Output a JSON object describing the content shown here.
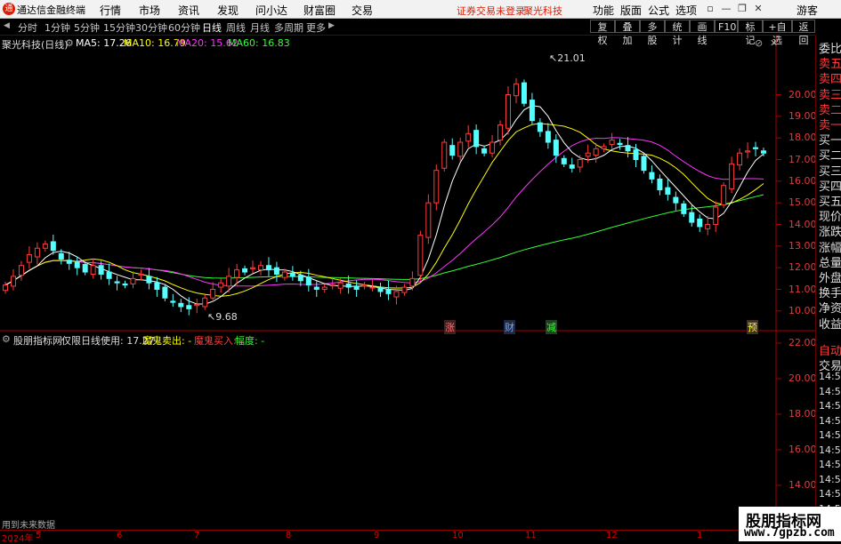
{
  "topbar": {
    "logo": "通",
    "app_title": "通达信金融终端",
    "menu": [
      "行情",
      "市场",
      "资讯",
      "发现",
      "问小达",
      "财富圈",
      "交易"
    ],
    "notice": "证券交易未登录",
    "stock_name": "聚光科技",
    "right_menu": [
      "功能",
      "版面",
      "公式",
      "选项"
    ],
    "guest": "游客"
  },
  "periodbar": {
    "periods": [
      "分时",
      "1分钟",
      "5分钟",
      "15分钟",
      "30分钟",
      "60分钟",
      "日线",
      "周线",
      "月线",
      "多周期",
      "更多"
    ],
    "active": "日线",
    "tools": [
      "复权",
      "叠加",
      "多股",
      "统计",
      "画线",
      "F10",
      "标记",
      "+自选",
      "返回"
    ]
  },
  "main_chart": {
    "title": "聚光科技(日线)",
    "ma": [
      {
        "label": "MA5: 17.26",
        "color": "#ffffff"
      },
      {
        "label": "MA10: 16.79",
        "color": "#ffff00"
      },
      {
        "label": "MA20: 15.62",
        "color": "#ff33ff"
      },
      {
        "label": "MA60: 16.83",
        "color": "#33ff33"
      }
    ],
    "y_ticks": [
      "20.00",
      "19.00",
      "18.00",
      "17.00",
      "16.00",
      "15.00",
      "14.00",
      "13.00",
      "12.00",
      "11.00",
      "10.00"
    ],
    "high_label": "21.01",
    "low_label": "9.68",
    "markers": [
      "涨",
      "财",
      "减",
      "预"
    ]
  },
  "indicator": {
    "name": "股朋指标网",
    "formula": "仅限日线使用: 17.27",
    "sell_label": "魔鬼卖出: -",
    "buy_label": "魔鬼买入: -",
    "range_label": "幅度: -",
    "y_ticks": [
      "22.00",
      "20.00",
      "18.00",
      "16.00",
      "14.00",
      "12.00"
    ],
    "footer": "用到未来数据"
  },
  "sidebar": {
    "quote_items": [
      "委比",
      "卖五",
      "卖四",
      "卖三",
      "卖二",
      "卖一",
      "买一",
      "买二",
      "买三",
      "买四",
      "买五",
      "现价",
      "涨跌",
      "涨幅",
      "总量",
      "外盘",
      "换手",
      "净资",
      "收益"
    ],
    "lower_items": [
      "自动",
      "交易",
      "14:5",
      "14:5",
      "14:5",
      "14:5",
      "14:5",
      "14:5",
      "14:5",
      "14:5",
      "14:5",
      "14:5",
      "14:5",
      "14:5"
    ]
  },
  "bottom": {
    "year": "2024年",
    "months": [
      "5",
      "6",
      "7",
      "8",
      "9",
      "10",
      "11",
      "12",
      "1",
      "2"
    ]
  },
  "watermark": {
    "title": "股朋指标网",
    "url": "www.7gpzb.com"
  },
  "chart_data": {
    "type": "candlestick",
    "title": "聚光科技(日线)",
    "ylim": [
      9.5,
      21.5
    ],
    "ma_values": {
      "MA5": 17.26,
      "MA10": 16.79,
      "MA20": 15.62,
      "MA60": 16.83
    },
    "price_ticks": [
      20,
      19,
      18,
      17,
      16,
      15,
      14,
      13,
      12,
      11,
      10
    ],
    "high": 21.01,
    "low": 9.68,
    "close_path": [
      11.2,
      11.6,
      12.1,
      12.6,
      12.9,
      13.1,
      12.8,
      12.4,
      12.2,
      12.0,
      11.8,
      12.1,
      11.7,
      11.5,
      11.3,
      11.2,
      11.5,
      11.7,
      11.3,
      11.0,
      10.6,
      10.4,
      10.2,
      10.1,
      10.3,
      10.6,
      11.0,
      11.3,
      11.6,
      11.9,
      11.8,
      12.0,
      12.1,
      11.9,
      11.7,
      11.8,
      11.6,
      11.4,
      11.2,
      11.0,
      11.1,
      11.2,
      11.3,
      11.1,
      11.0,
      11.2,
      11.1,
      10.9,
      10.8,
      10.9,
      11.1,
      11.5,
      13.5,
      15.0,
      16.5,
      17.8,
      17.2,
      17.8,
      18.2,
      17.6,
      17.3,
      17.8,
      18.6,
      20.0,
      20.5,
      19.6,
      18.8,
      18.3,
      17.8,
      17.2,
      16.8,
      16.6,
      17.0,
      17.3,
      17.5,
      17.6,
      17.9,
      17.7,
      17.4,
      17.0,
      16.5,
      16.1,
      15.6,
      15.4,
      15.0,
      14.5,
      14.1,
      13.9,
      14.0,
      14.8,
      15.8,
      16.8,
      17.3,
      17.4,
      17.5,
      17.3
    ]
  }
}
